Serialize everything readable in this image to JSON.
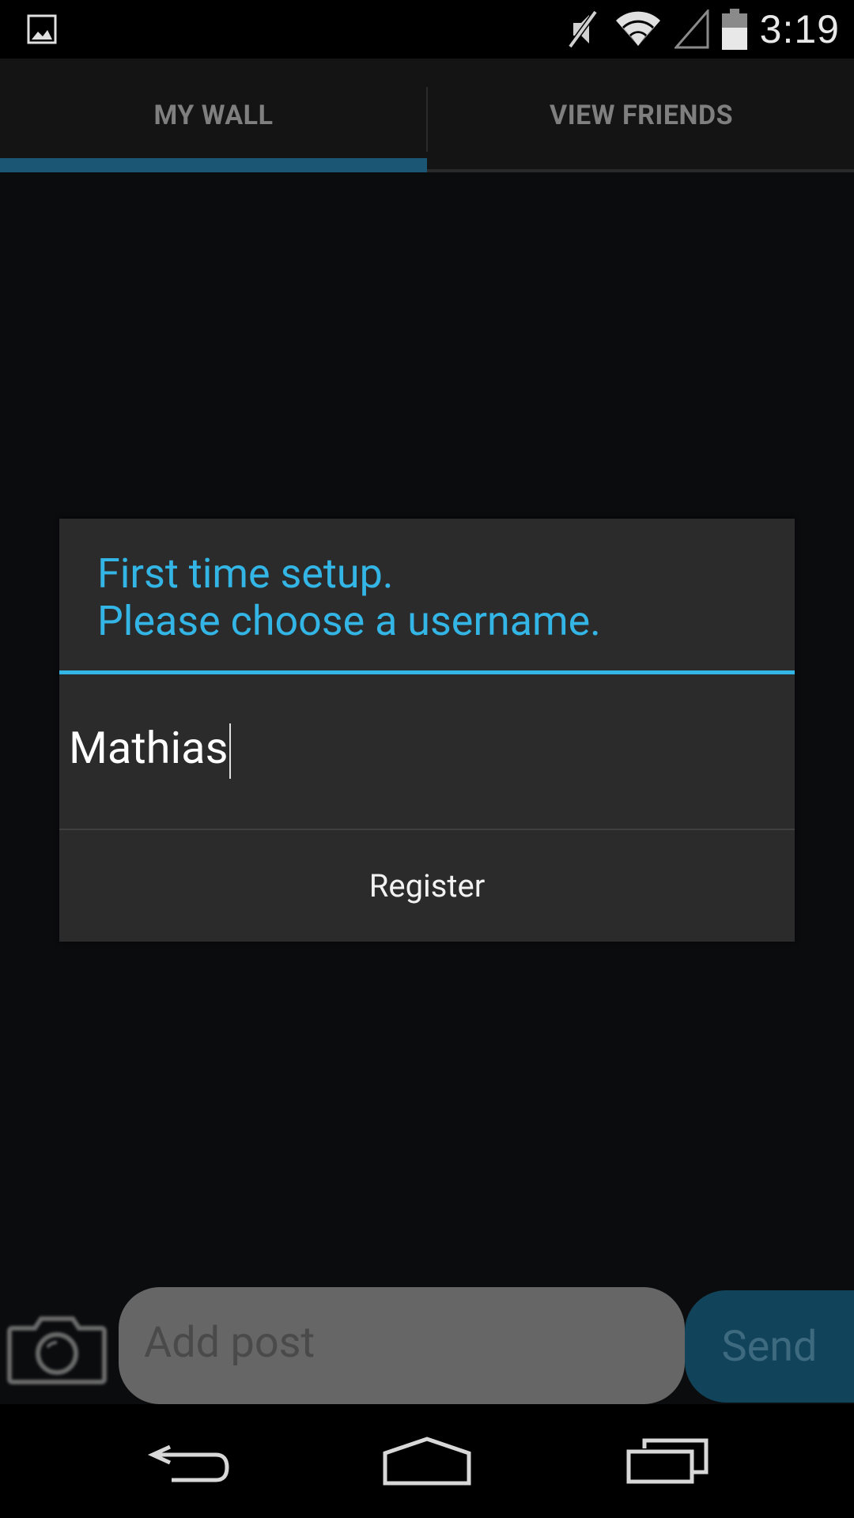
{
  "status_bar": {
    "time": "3:19",
    "icons": [
      "image-notification-icon",
      "mute-icon",
      "wifi-icon",
      "signal-icon",
      "battery-icon"
    ]
  },
  "tabs": [
    {
      "label": "MY WALL",
      "selected": true
    },
    {
      "label": "VIEW FRIENDS",
      "selected": false
    }
  ],
  "dialog": {
    "title_line1": "First time setup.",
    "title_line2": "Please choose a username.",
    "username_value": "Mathias",
    "register_label": "Register"
  },
  "post_bar": {
    "placeholder": "Add post",
    "send_label": "Send"
  },
  "colors": {
    "accent": "#33b5e5",
    "tab_indicator": "#1b5774",
    "send_button": "#11435a",
    "dialog_bg": "#2b2b2b"
  }
}
